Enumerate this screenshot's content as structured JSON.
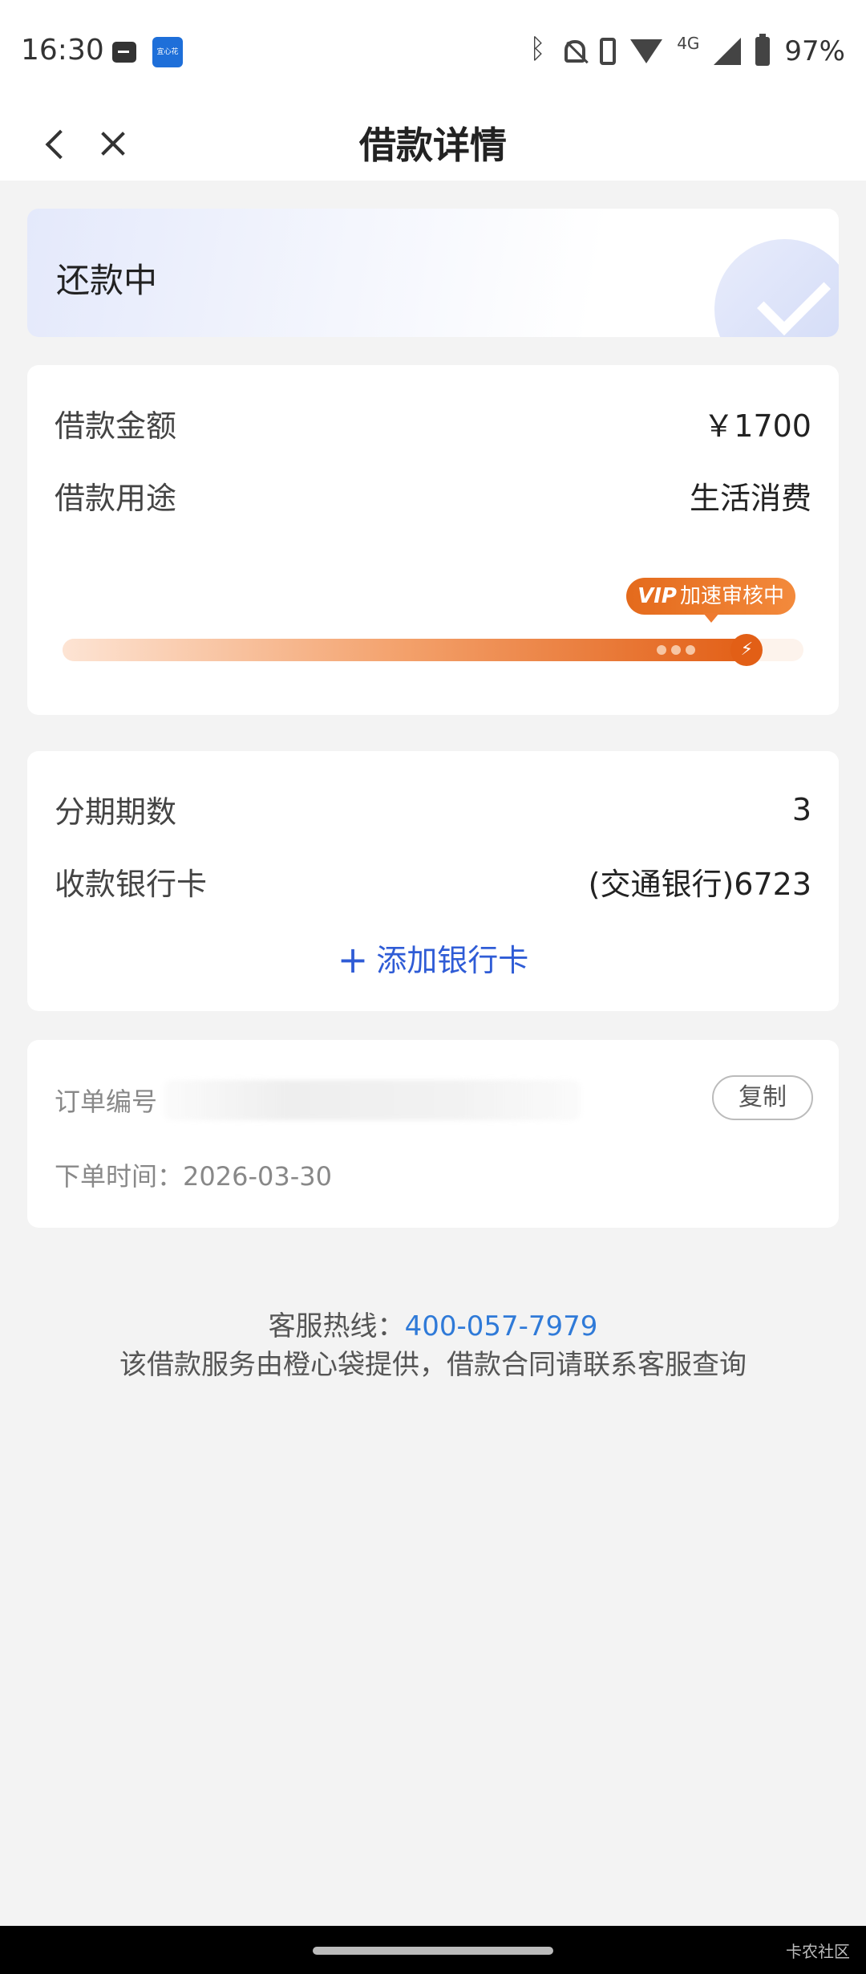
{
  "status_bar": {
    "time": "16:30",
    "app_icon_text": "宜心花",
    "network": "4G",
    "battery": "97%"
  },
  "nav": {
    "title": "借款详情",
    "back_icon": "chevron-left-icon",
    "close_icon": "close-icon"
  },
  "status_card": {
    "status": "还款中"
  },
  "loan": {
    "amount_label": "借款金额",
    "amount_value": "￥1700",
    "purpose_label": "借款用途",
    "purpose_value": "生活消费",
    "vip_mark": "VIP",
    "vip_text": "加速审核中",
    "progress_fraction": 0.93
  },
  "installment": {
    "periods_label": "分期期数",
    "periods_value": "3",
    "bank_label": "收款银行卡",
    "bank_value": "(交通银行)6723",
    "add_card_label": "添加银行卡"
  },
  "order": {
    "order_label": "订单编号",
    "copy_label": "复制",
    "time_text": "下单时间：2026-03-30"
  },
  "footer": {
    "hotline_label": "客服热线：",
    "hotline_number": "400-057-7979",
    "note": "该借款服务由橙心袋提供，借款合同请联系客服查询"
  },
  "watermark": "卡农社区",
  "colors": {
    "accent_blue": "#2f5cd6",
    "link_blue": "#2f7ad8",
    "progress_orange": "#e25f16",
    "background": "#f3f3f3"
  }
}
